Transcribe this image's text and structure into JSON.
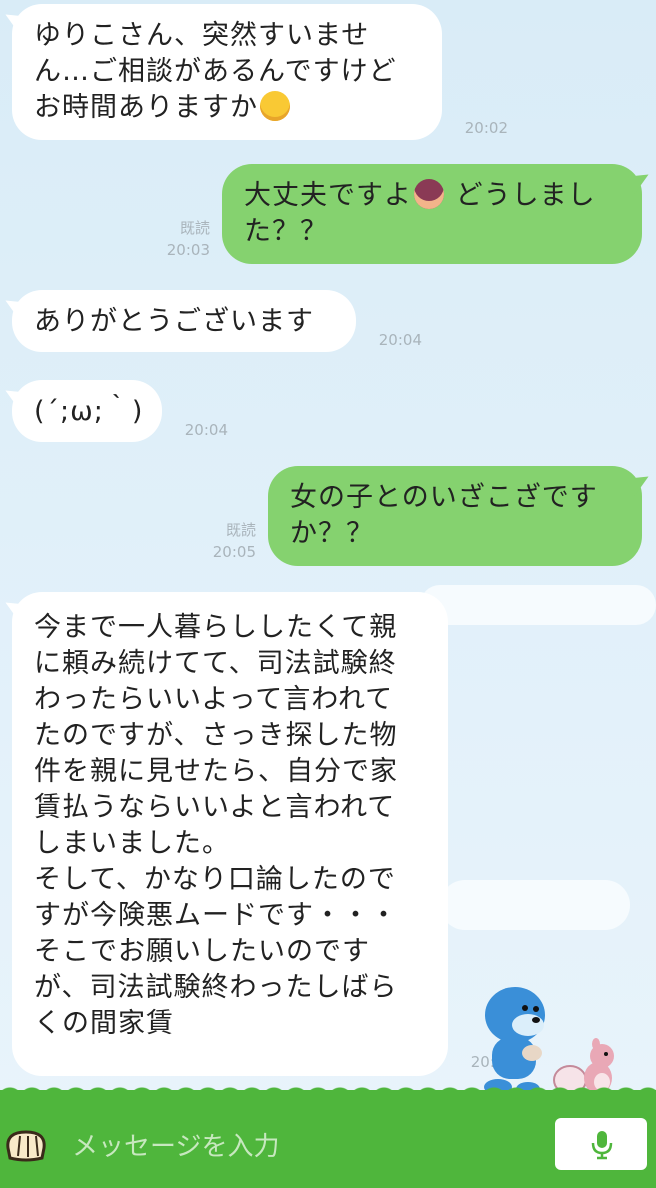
{
  "messages": [
    {
      "side": "left",
      "lines": [
        "ゆりこさん、突然すいませ",
        "ん…ご相談があるんですけど",
        "お時間ありますか"
      ],
      "emoji": "loudly-crying-face",
      "time": "20:02"
    },
    {
      "side": "right",
      "lines": [
        "大丈夫ですよ",
        "どうしまし",
        "た？？"
      ],
      "emoji": "woman-gesturing-ok",
      "read": "既読",
      "time": "20:03"
    },
    {
      "side": "left",
      "lines": [
        "ありがとうございます"
      ],
      "time": "20:04"
    },
    {
      "side": "left",
      "lines": [
        "(´;ω;｀)"
      ],
      "time": "20:04"
    },
    {
      "side": "right",
      "lines": [
        "女の子とのいざこざです",
        "か？？"
      ],
      "read": "既読",
      "time": "20:05"
    },
    {
      "side": "left",
      "lines": [
        "今まで一人暮らししたくて親",
        "に頼み続けてて、司法試験終",
        "わったらいいよって言われて",
        "たのですが、さっき探した物",
        "件を親に見せたら、自分で家",
        "賃払うならいいよと言われて",
        "しまいました。",
        "そして、かなり口論したので",
        "すが今険悪ムードです・・・",
        "そこでお願いしたいのです",
        "が、司法試験終わったしばら",
        "くの間家賃"
      ],
      "time": "20:06"
    }
  ],
  "input": {
    "placeholder": "メッセージを入力"
  },
  "icons": {
    "menu": "bread-icon",
    "mic": "microphone-icon"
  },
  "colors": {
    "outgoing": "#85d26f",
    "incoming": "#ffffff",
    "grass": "#4fb63c",
    "sky": "#d9ecf7"
  }
}
